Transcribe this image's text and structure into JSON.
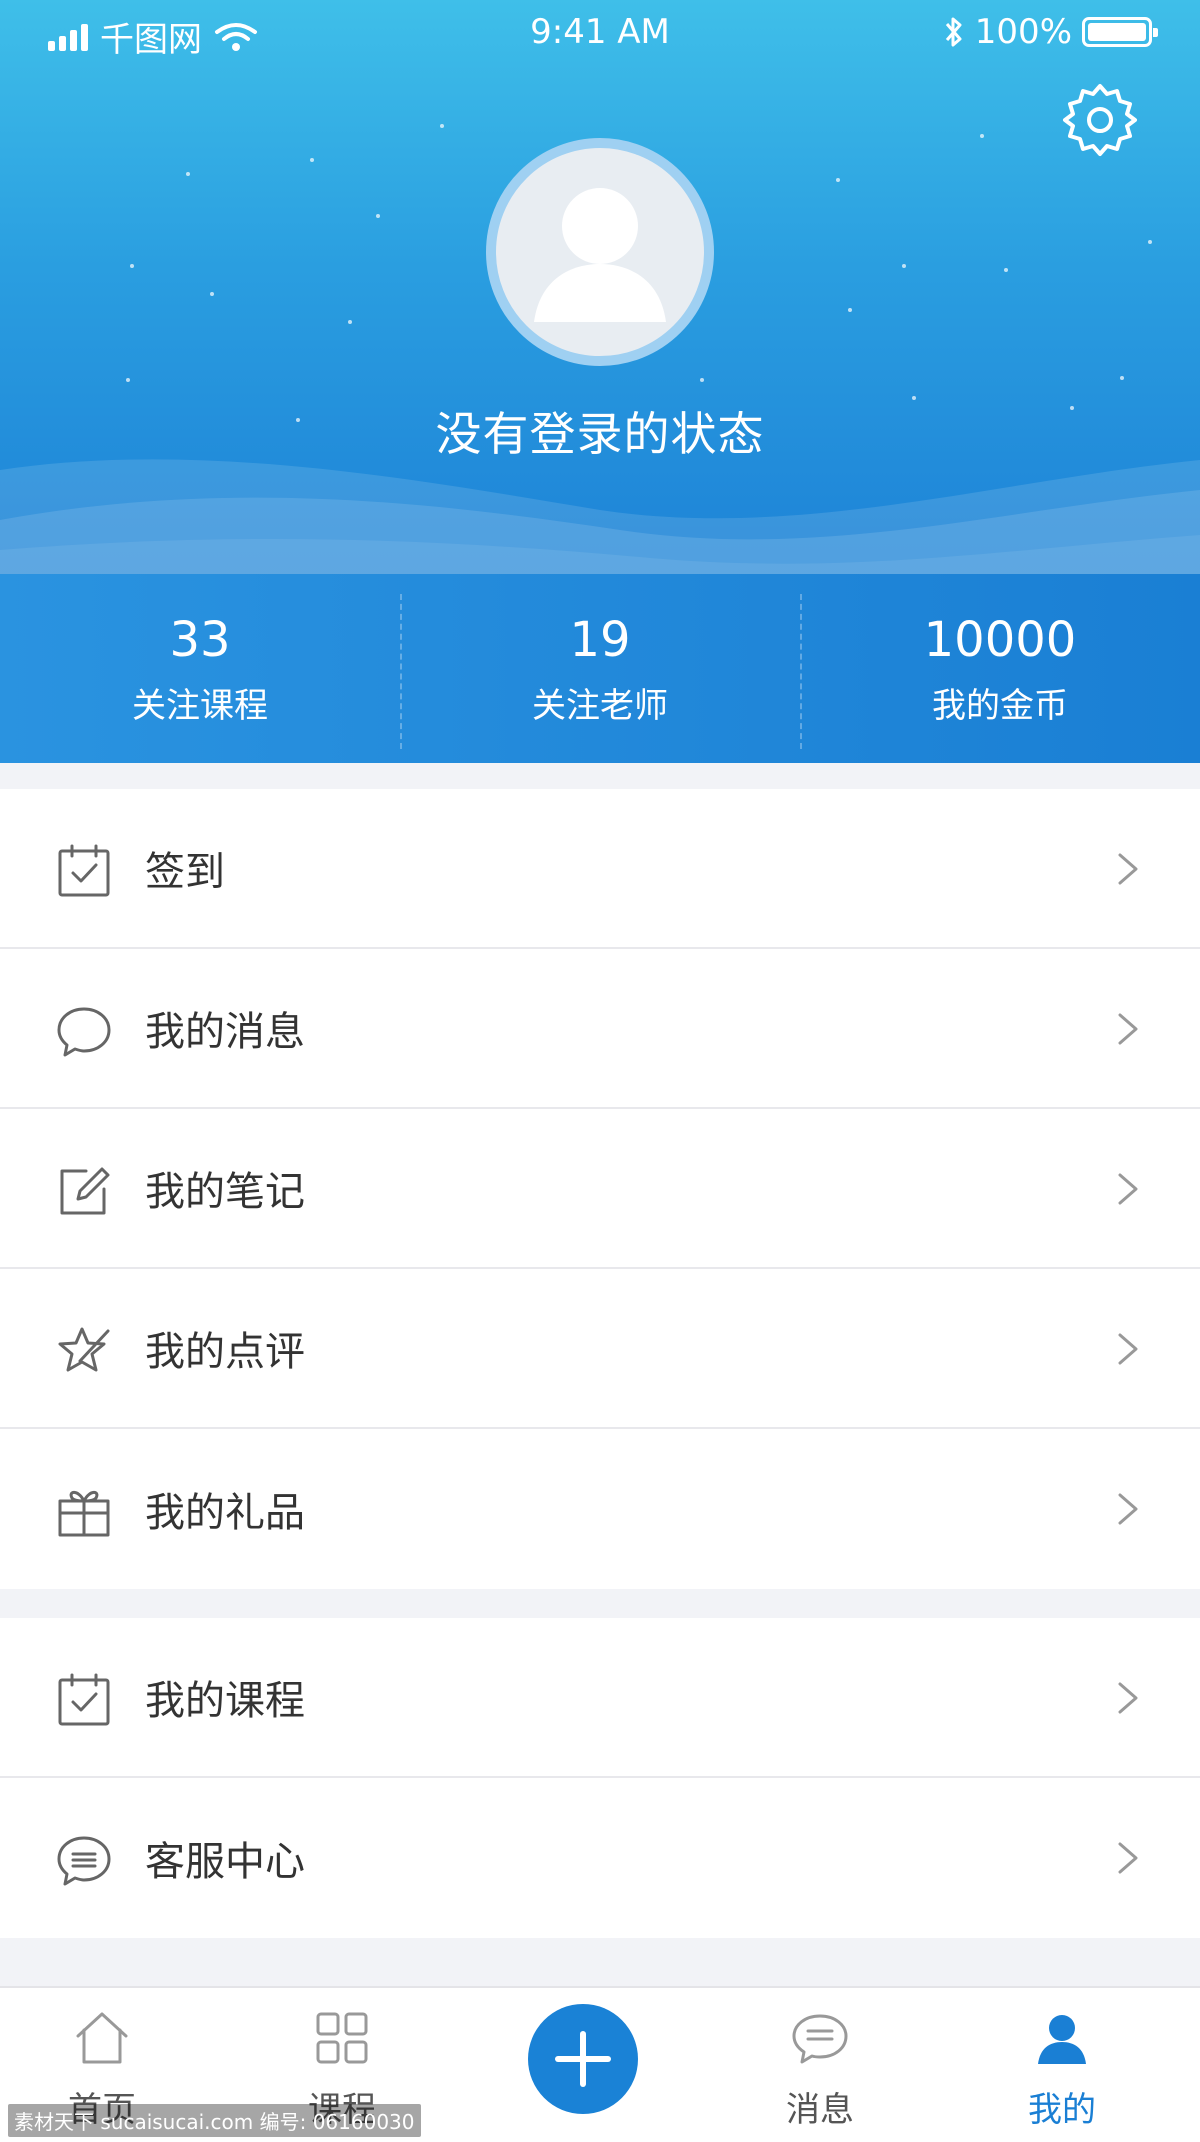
{
  "status_bar": {
    "carrier": "千图网",
    "time": "9:41 AM",
    "battery": "100%"
  },
  "profile": {
    "login_status": "没有登录的状态"
  },
  "stats": [
    {
      "value": "33",
      "label": "关注课程"
    },
    {
      "value": "19",
      "label": "关注老师"
    },
    {
      "value": "10000",
      "label": "我的金币"
    }
  ],
  "menu_group_1": [
    {
      "label": "签到",
      "icon": "calendar-check-icon"
    },
    {
      "label": "我的消息",
      "icon": "chat-bubble-icon"
    },
    {
      "label": "我的笔记",
      "icon": "edit-note-icon"
    },
    {
      "label": "我的点评",
      "icon": "star-pen-icon"
    },
    {
      "label": "我的礼品",
      "icon": "gift-icon"
    }
  ],
  "menu_group_2": [
    {
      "label": "我的课程",
      "icon": "calendar-check-icon"
    },
    {
      "label": "客服中心",
      "icon": "service-chat-icon"
    }
  ],
  "tab_bar": {
    "items": [
      {
        "label": "首页",
        "icon": "home-icon"
      },
      {
        "label": "课程",
        "icon": "grid-icon"
      },
      {
        "label": "消息",
        "icon": "message-icon"
      },
      {
        "label": "我的",
        "icon": "user-icon",
        "active": true
      }
    ],
    "add_button_icon": "plus-icon"
  },
  "colors": {
    "primary": "#1a7fd4",
    "header_top": "#3fbfe9",
    "text": "#333333",
    "icon_gray": "#666666"
  },
  "watermark": "素材天下 sucaisucai.com  编号: 06160030"
}
